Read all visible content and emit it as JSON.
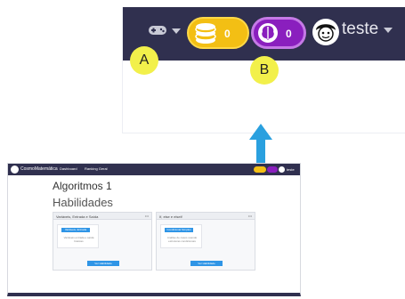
{
  "zoom": {
    "coins_value": "0",
    "brain_value": "0",
    "username": "teste"
  },
  "markers": {
    "a": "A",
    "b": "B"
  },
  "screenshot": {
    "brand": "CosmoMatemática",
    "nav_links": [
      "Dashboard",
      "Ranking Geral"
    ],
    "username": "teste",
    "page_title": "Algoritmos 1",
    "section_title": "Habilidades",
    "cards": [
      {
        "title": "Variáveis, Entrada e Saída",
        "menu": "•••",
        "chip": "Variáveis, Entrada",
        "text": "Variáveis entrada e saída básicas",
        "button": "Ver Habilidade"
      },
      {
        "title": "If, else e elseif",
        "menu": "•••",
        "chip": "Condicional Simples",
        "text": "Análise de casos usando estruturas condicionais",
        "button": "Ver Habilidade"
      }
    ]
  },
  "colors": {
    "navbar": "#30304f",
    "coins_pill": "#f3bf14",
    "brain_pill": "#8a1fbe",
    "marker": "#f2f04b",
    "arrow": "#2aa0df",
    "button": "#2f95e6"
  },
  "icons": {
    "gamepad": "gamepad-icon",
    "coins": "coins-icon",
    "brain": "brain-icon",
    "avatar": "user-avatar-icon",
    "dropdown": "chevron-down-icon",
    "arrow": "arrow-up-icon"
  }
}
